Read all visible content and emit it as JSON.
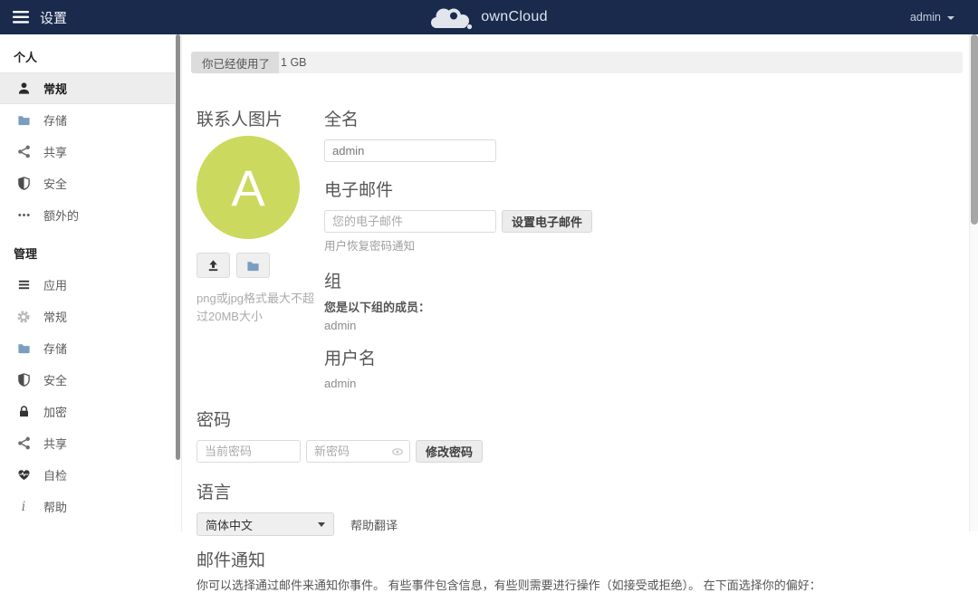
{
  "header": {
    "app_title": "设置",
    "logo_text": "ownCloud",
    "user_menu_label": "admin"
  },
  "sidebar": {
    "sections": [
      {
        "label": "个人",
        "items": [
          {
            "label": "常规",
            "icon": "user-icon",
            "active": true
          },
          {
            "label": "存储",
            "icon": "folder-icon",
            "active": false
          },
          {
            "label": "共享",
            "icon": "share-icon",
            "active": false
          },
          {
            "label": "安全",
            "icon": "shield-icon",
            "active": false
          },
          {
            "label": "额外的",
            "icon": "ellipsis-icon",
            "active": false
          }
        ]
      },
      {
        "label": "管理",
        "items": [
          {
            "label": "应用",
            "icon": "list-icon",
            "active": false
          },
          {
            "label": "常规",
            "icon": "gear-icon",
            "active": false
          },
          {
            "label": "存储",
            "icon": "folder-icon",
            "active": false
          },
          {
            "label": "安全",
            "icon": "shield-icon",
            "active": false
          },
          {
            "label": "加密",
            "icon": "lock-icon",
            "active": false
          },
          {
            "label": "共享",
            "icon": "share-icon",
            "active": false
          },
          {
            "label": "自检",
            "icon": "heartbeat-icon",
            "active": false
          },
          {
            "label": "帮助",
            "icon": "info-icon",
            "active": false
          }
        ]
      }
    ]
  },
  "main": {
    "quota": {
      "used_label": "你已经使用了",
      "total_value": "1 GB"
    },
    "profile": {
      "picture_heading": "联系人图片",
      "avatar_letter": "A",
      "upload_hint": "png或jpg格式最大不超过20MB大小",
      "fullname_heading": "全名",
      "fullname_value": "admin",
      "email_heading": "电子邮件",
      "email_placeholder": "您的电子邮件",
      "email_button_label": "设置电子邮件",
      "email_hint": "用户恢复密码通知",
      "groups_heading": "组",
      "groups_member_label": "您是以下组的成员：",
      "groups_value": "admin",
      "username_heading": "用户名",
      "username_value": "admin"
    },
    "password": {
      "heading": "密码",
      "current_placeholder": "当前密码",
      "new_placeholder": "新密码",
      "change_button_label": "修改密码"
    },
    "language": {
      "heading": "语言",
      "selected_option": "简体中文",
      "help_translate_label": "帮助翻译"
    },
    "email_notifications": {
      "heading": "邮件通知",
      "description": "你可以选择通过邮件来通知你事件。 有些事件包含信息，有些则需要进行操作（如接受或拒绝）。 在下面选择你的偏好："
    }
  },
  "colors": {
    "header_bg": "#1a2a4d",
    "avatar_bg": "#cbd95e",
    "folder_icon_blue": "#7b9dbf",
    "active_item_bg": "#ededed",
    "quota_used_bg": "#dcdcdc"
  }
}
